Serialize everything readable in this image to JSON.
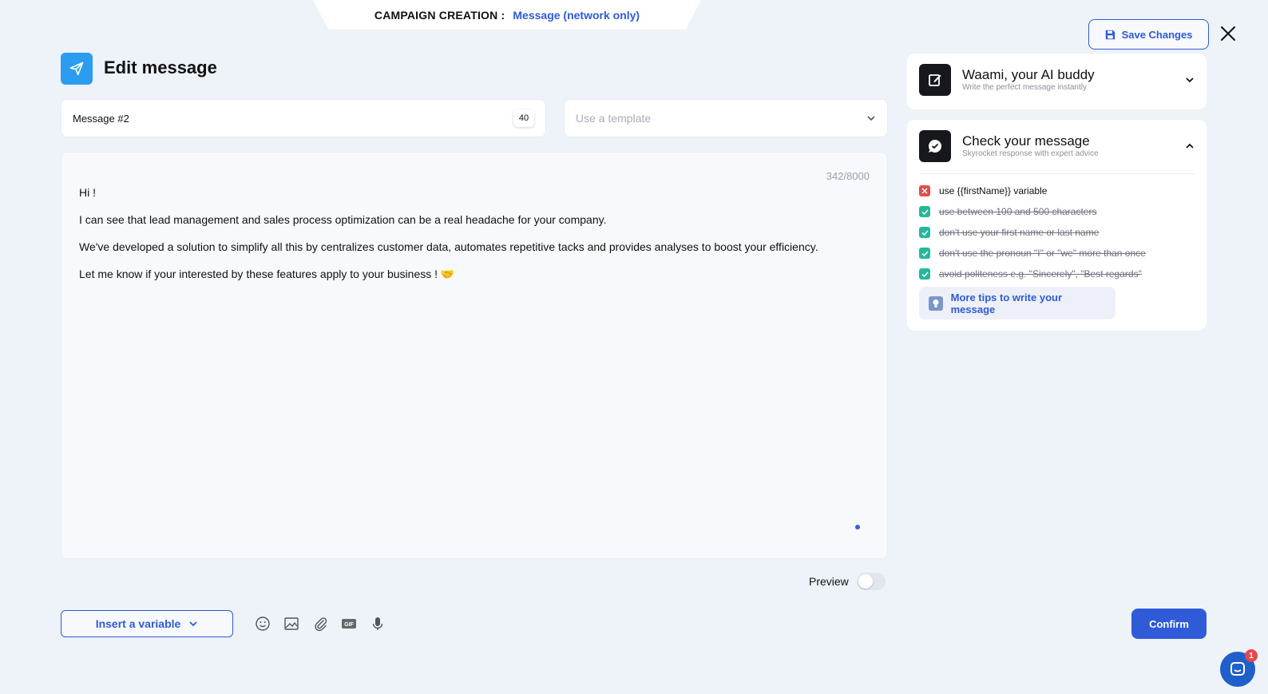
{
  "header": {
    "label": "CAMPAIGN CREATION :",
    "value": "Message (network only)",
    "save_label": "Save Changes",
    "title": "Edit message"
  },
  "fields": {
    "message_name": "Message #2",
    "message_name_count": "40",
    "template_placeholder": "Use a template"
  },
  "editor": {
    "char_count": "342/8000",
    "paragraphs": [
      "Hi !",
      "I can see that lead management and sales process optimization can be a real headache for your company.",
      "We've developed a solution to simplify all this by centralizes customer data, automates repetitive tacks and provides analyses to boost your efficiency.",
      "Let me know if your interested by these features apply to your business ! 🤝"
    ]
  },
  "preview_label": "Preview",
  "preview_on": false,
  "toolbar": {
    "insert_variable": "Insert a variable",
    "tools": [
      "emoji-icon",
      "image-icon",
      "attachment-icon",
      "gif-icon",
      "microphone-icon"
    ],
    "gif_text": "GIF"
  },
  "confirm_label": "Confirm",
  "ai_card": {
    "title": "Waami, your AI buddy",
    "subtitle": "Write the perfect message instantly"
  },
  "check_card": {
    "title": "Check your message",
    "subtitle": "Skyrocket response with expert advice",
    "items": [
      {
        "text": "use {{firstName}} variable",
        "ok": false
      },
      {
        "text": "use between 100 and 500 characters",
        "ok": true
      },
      {
        "text": "don't use your first name or last name",
        "ok": true
      },
      {
        "text": "don't use the pronoun \"I\" or \"we\" more than once",
        "ok": true
      },
      {
        "text": "avoid politeness e.g. \"Sincerely\", \"Best regards\"",
        "ok": true
      }
    ],
    "tips_label": "More tips to write your message"
  },
  "chat": {
    "badge": "1"
  },
  "colors": {
    "accent": "#2f5bd8",
    "ok": "#25b89a",
    "fail": "#e44c4c",
    "header_icon": "#2b9cf0"
  }
}
